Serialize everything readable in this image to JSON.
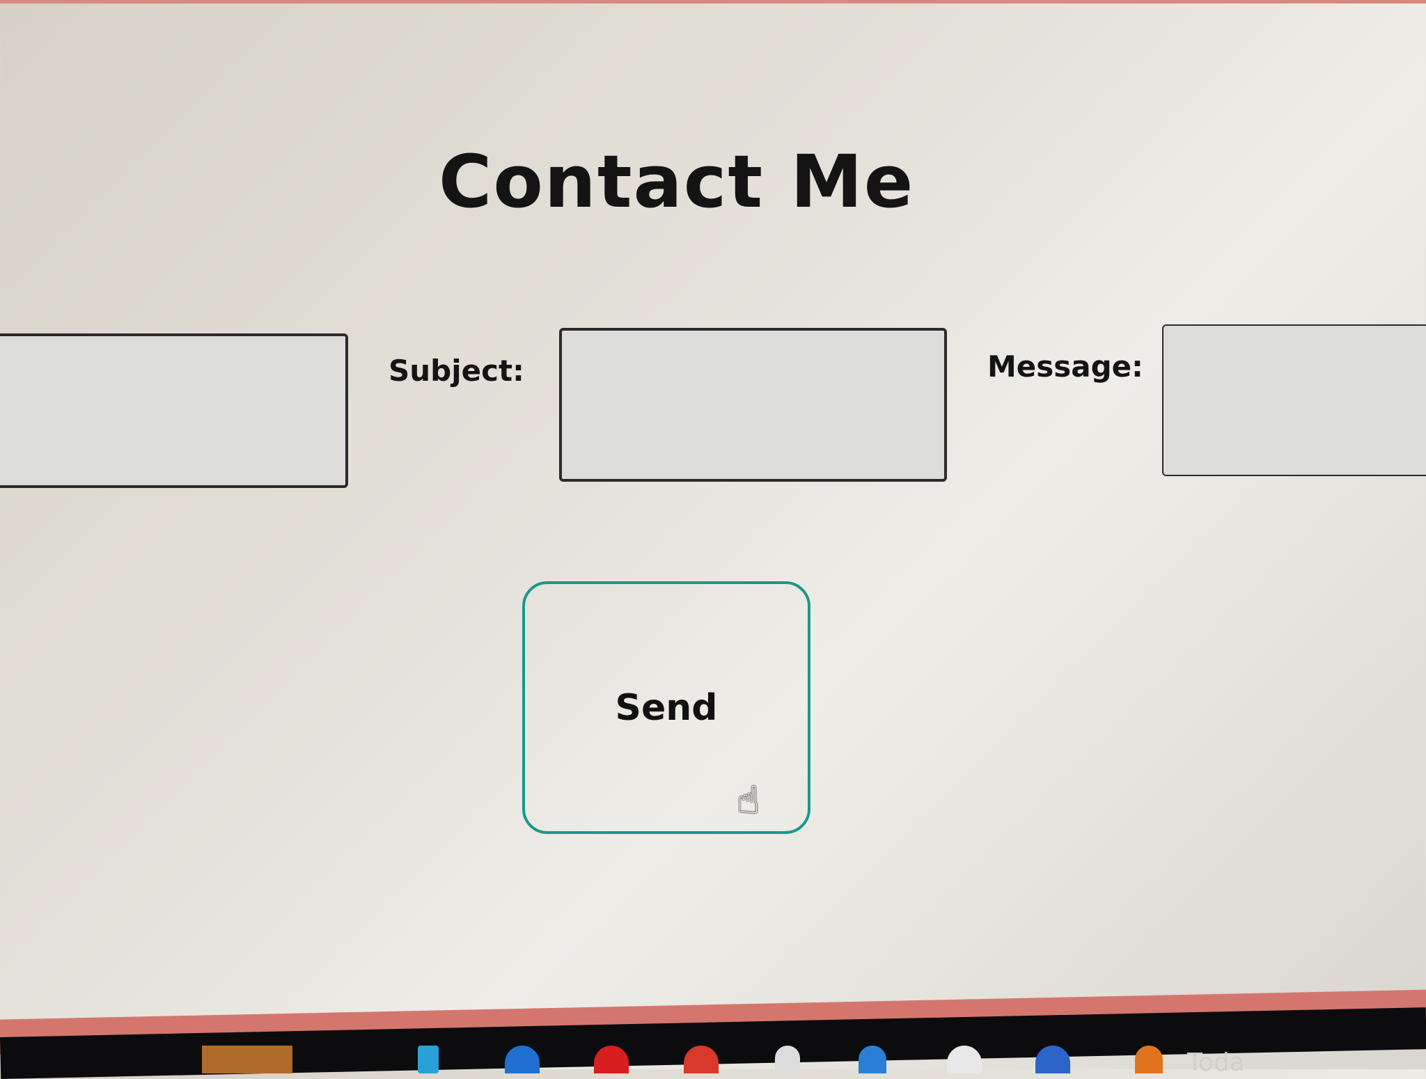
{
  "page": {
    "title": "Contact Me"
  },
  "form": {
    "subject_label": "Subject:",
    "message_label": "Message:",
    "send_label": "Send"
  },
  "taskbar": {
    "weather_text": "Toda"
  },
  "colors": {
    "accent_border": "#18998a",
    "window_frame": "#d5766e"
  }
}
